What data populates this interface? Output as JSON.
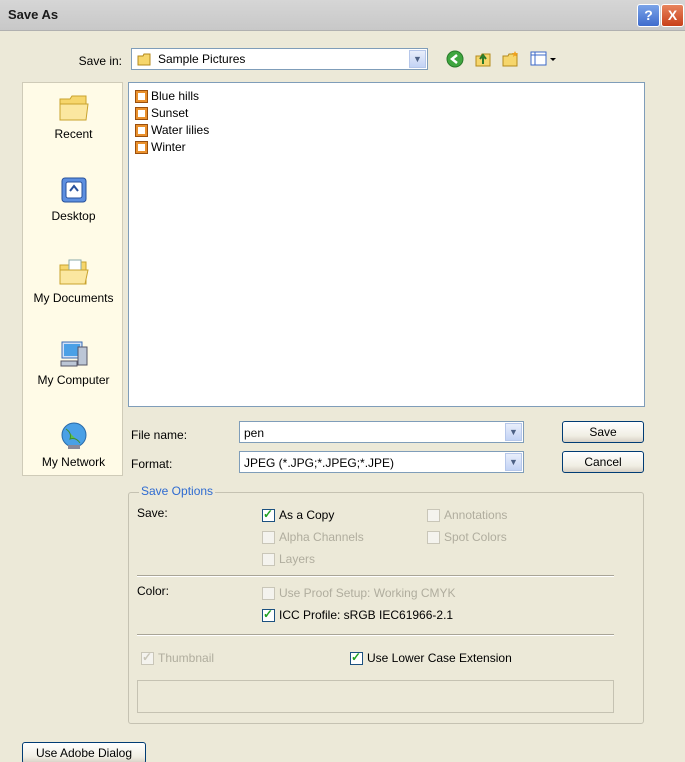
{
  "window": {
    "title": "Save As",
    "help_glyph": "?",
    "close_glyph": "X"
  },
  "toolbar": {
    "save_in_label": "Save in:",
    "save_in_value": "Sample Pictures",
    "icons": [
      "back-icon",
      "up-folder-icon",
      "new-folder-icon",
      "view-menu-icon"
    ]
  },
  "places": [
    {
      "label": "Recent",
      "icon": "recent-folder-icon"
    },
    {
      "label": "Desktop",
      "icon": "desktop-icon"
    },
    {
      "label": "My Documents",
      "icon": "my-documents-icon"
    },
    {
      "label": "My Computer",
      "icon": "my-computer-icon"
    },
    {
      "label": "My Network",
      "icon": "my-network-icon"
    }
  ],
  "files": [
    "Blue hills",
    "Sunset",
    "Water lilies",
    "Winter"
  ],
  "form": {
    "file_name_label": "File name:",
    "file_name_value": "pen",
    "format_label": "Format:",
    "format_value": "JPEG (*.JPG;*.JPEG;*.JPE)",
    "save_button": "Save",
    "cancel_button": "Cancel"
  },
  "save_options": {
    "legend": "Save Options",
    "save_label": "Save:",
    "as_a_copy": {
      "label": "As a Copy",
      "checked": true,
      "enabled": true
    },
    "annotations": {
      "label": "Annotations",
      "checked": false,
      "enabled": false
    },
    "alpha_channels": {
      "label": "Alpha Channels",
      "checked": false,
      "enabled": false
    },
    "spot_colors": {
      "label": "Spot Colors",
      "checked": false,
      "enabled": false
    },
    "layers": {
      "label": "Layers",
      "checked": false,
      "enabled": false
    },
    "color_label": "Color:",
    "use_proof_setup": {
      "label": "Use Proof Setup:  Working CMYK",
      "checked": false,
      "enabled": false
    },
    "icc_profile": {
      "label": "ICC Profile:  sRGB IEC61966-2.1",
      "checked": true,
      "enabled": true
    },
    "thumbnail": {
      "label": "Thumbnail",
      "checked": true,
      "enabled": false
    },
    "lower_case_ext": {
      "label": "Use Lower Case Extension",
      "checked": true,
      "enabled": true
    }
  },
  "adobe_dialog_button": "Use Adobe Dialog"
}
